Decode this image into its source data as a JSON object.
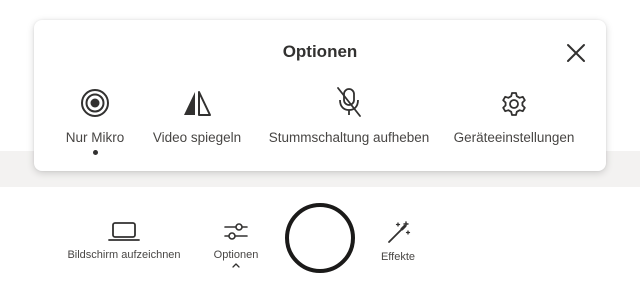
{
  "options_panel": {
    "title": "Optionen",
    "items": [
      {
        "label": "Nur Mikro",
        "icon": "microphone-only-icon",
        "selected": true
      },
      {
        "label": "Video spiegeln",
        "icon": "mirror-icon"
      },
      {
        "label": "Stummschaltung aufheben",
        "icon": "mic-off-icon"
      },
      {
        "label": "Geräteeinstellungen",
        "icon": "gear-icon"
      }
    ],
    "close_icon": "close-icon"
  },
  "toolbar": {
    "screen_record": {
      "label": "Bildschirm aufzeichnen",
      "icon": "laptop-icon"
    },
    "options": {
      "label": "Optionen",
      "icon": "sliders-icon",
      "expanded": true
    },
    "effects": {
      "label": "Effekte",
      "icon": "magic-wand-icon"
    }
  },
  "colors": {
    "text": "#323130",
    "panel_background": "#ffffff",
    "page_band": "#f3f2f1",
    "shutter_ring": "#1b1a19"
  }
}
